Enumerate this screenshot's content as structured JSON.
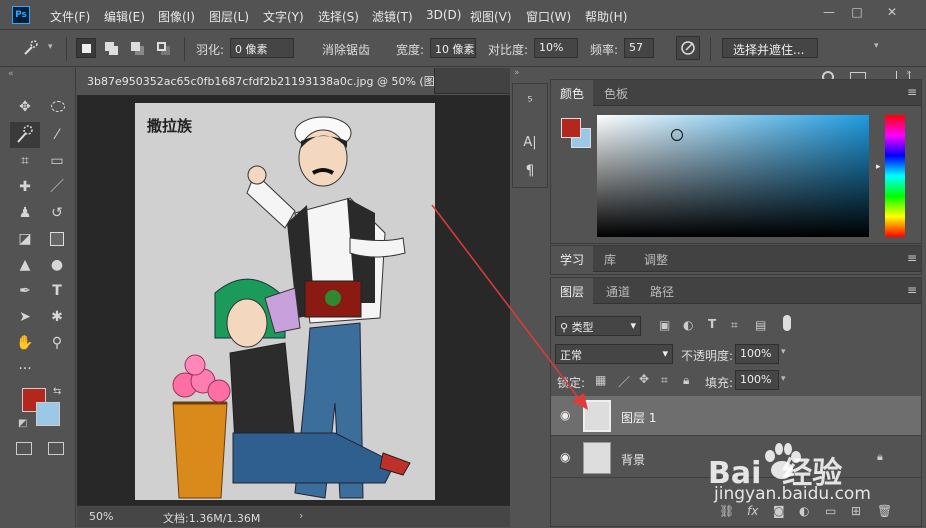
{
  "app": {
    "logo": "Ps"
  },
  "menu": [
    "文件(F)",
    "编辑(E)",
    "图像(I)",
    "图层(L)",
    "文字(Y)",
    "选择(S)",
    "滤镜(T)",
    "3D(D)",
    "视图(V)",
    "窗口(W)",
    "帮助(H)"
  ],
  "window_buttons": {
    "minimize": "—",
    "maximize": "□",
    "close": "✕"
  },
  "options": {
    "feather_label": "羽化:",
    "feather_value": "0 像素",
    "antialias_label": "消除锯齿",
    "width_label": "宽度:",
    "width_value": "10 像素",
    "contrast_label": "对比度:",
    "contrast_value": "10%",
    "frequency_label": "频率:",
    "frequency_value": "57",
    "select_mask_label": "选择并遮住..."
  },
  "document": {
    "tab_title": "3b87e950352ac65c0fb1687cfdf2b21193138a0c.jpg @ 50% (图...",
    "artboard_text": "撒拉族",
    "zoom": "50%",
    "doc_size": "文档:1.36M/1.36M"
  },
  "mini_panel": {
    "paragraph_icon": "¶",
    "char_icon": "A|"
  },
  "color_panel": {
    "tabs": [
      "颜色",
      "色板"
    ],
    "foreground": "#b3281c",
    "background": "#9ac8e6",
    "field_hue": "#1f9be0"
  },
  "learn_panel": {
    "tabs": [
      "学习",
      "库",
      "调整"
    ]
  },
  "layers_panel": {
    "tabs": [
      "图层",
      "通道",
      "路径"
    ],
    "filter_kind": "类型",
    "blend_mode": "正常",
    "opacity_label": "不透明度:",
    "opacity_value": "100%",
    "lock_label": "锁定:",
    "fill_label": "填充:",
    "fill_value": "100%",
    "layers": [
      {
        "name": "图层 1",
        "selected": true,
        "locked": false
      },
      {
        "name": "背景",
        "selected": false,
        "locked": true
      }
    ]
  },
  "watermark": {
    "brand": "Bai  经验",
    "url": "jingyan.baidu.com"
  },
  "colors": {
    "annotation_arrow": "#e03b3b",
    "paw": "#ffffff"
  }
}
